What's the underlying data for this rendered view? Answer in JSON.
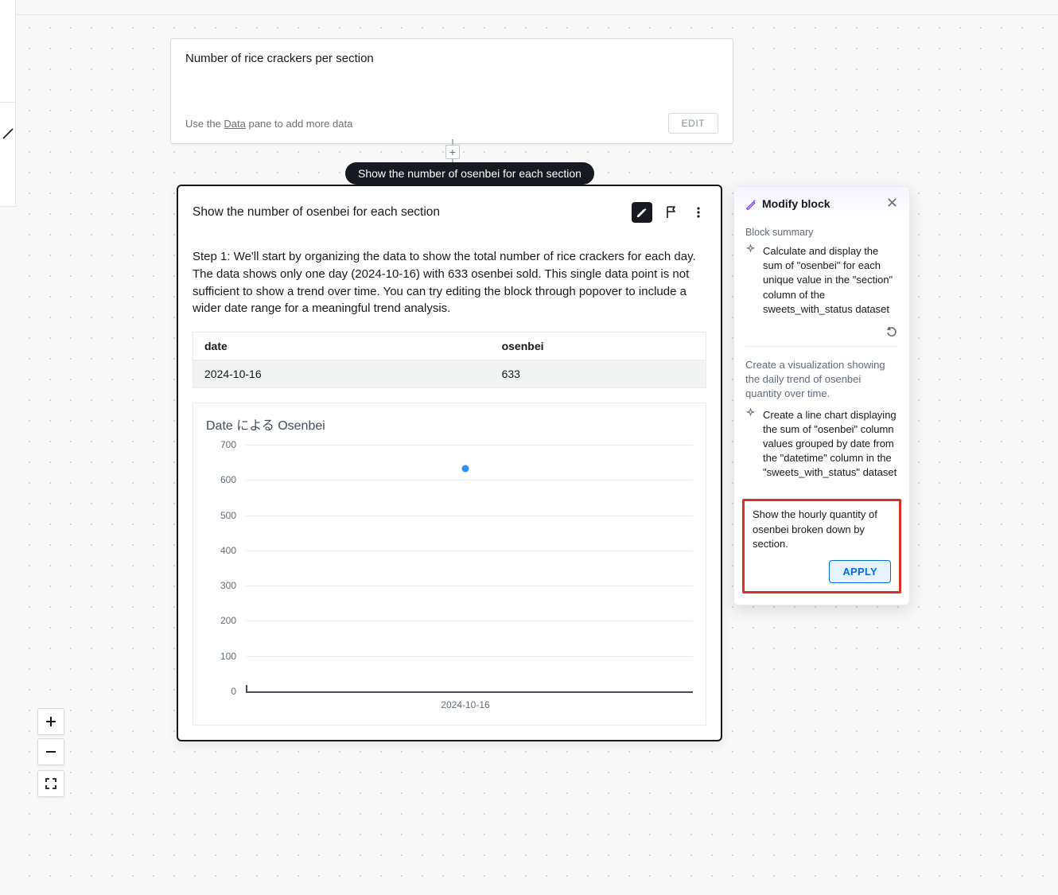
{
  "top_card": {
    "caption": "Number of rice crackers per section",
    "hint_prefix": "Use the ",
    "hint_link": "Data",
    "hint_suffix": " pane to add more data",
    "edit_label": "EDIT"
  },
  "pill_text": "Show the number of osenbei for each section",
  "block": {
    "title": "Show the number of osenbei for each section",
    "step_body": "Step 1: We'll start by organizing the data to show the total number of rice crackers for each day. The data shows only one day (2024-10-16) with 633 osenbei sold. This single data point is not sufficient to show a trend over time. You can try editing the block through popover to include a wider date range for a meaningful trend analysis.",
    "table": {
      "cols": [
        "date",
        "osenbei"
      ],
      "rows": [
        [
          "2024-10-16",
          "633"
        ]
      ]
    }
  },
  "side_panel": {
    "title": "Modify block",
    "summary_title": "Block summary",
    "item1": "Calculate and display the sum of \"osenbei\" for each unique value in the \"section\" column of the sweets_with_status dataset",
    "subdesc": "Create a visualization showing the daily trend of osenbei quantity over time.",
    "item2": "Create a line chart displaying the sum of \"osenbei\" column values grouped by date from the \"datetime\" column in the \"sweets_with_status\" dataset",
    "prompt": "Show the hourly quantity of osenbei broken down by section.",
    "apply_label": "APPLY"
  },
  "chart_data": {
    "type": "scatter",
    "title": "Date による Osenbei",
    "x": [
      "2024-10-16"
    ],
    "values": [
      633
    ],
    "xlabel": "",
    "ylabel": "",
    "ylim": [
      0,
      700
    ],
    "y_ticks": [
      0,
      100,
      200,
      300,
      400,
      500,
      600,
      700
    ],
    "point_color": "#2e90fa"
  }
}
